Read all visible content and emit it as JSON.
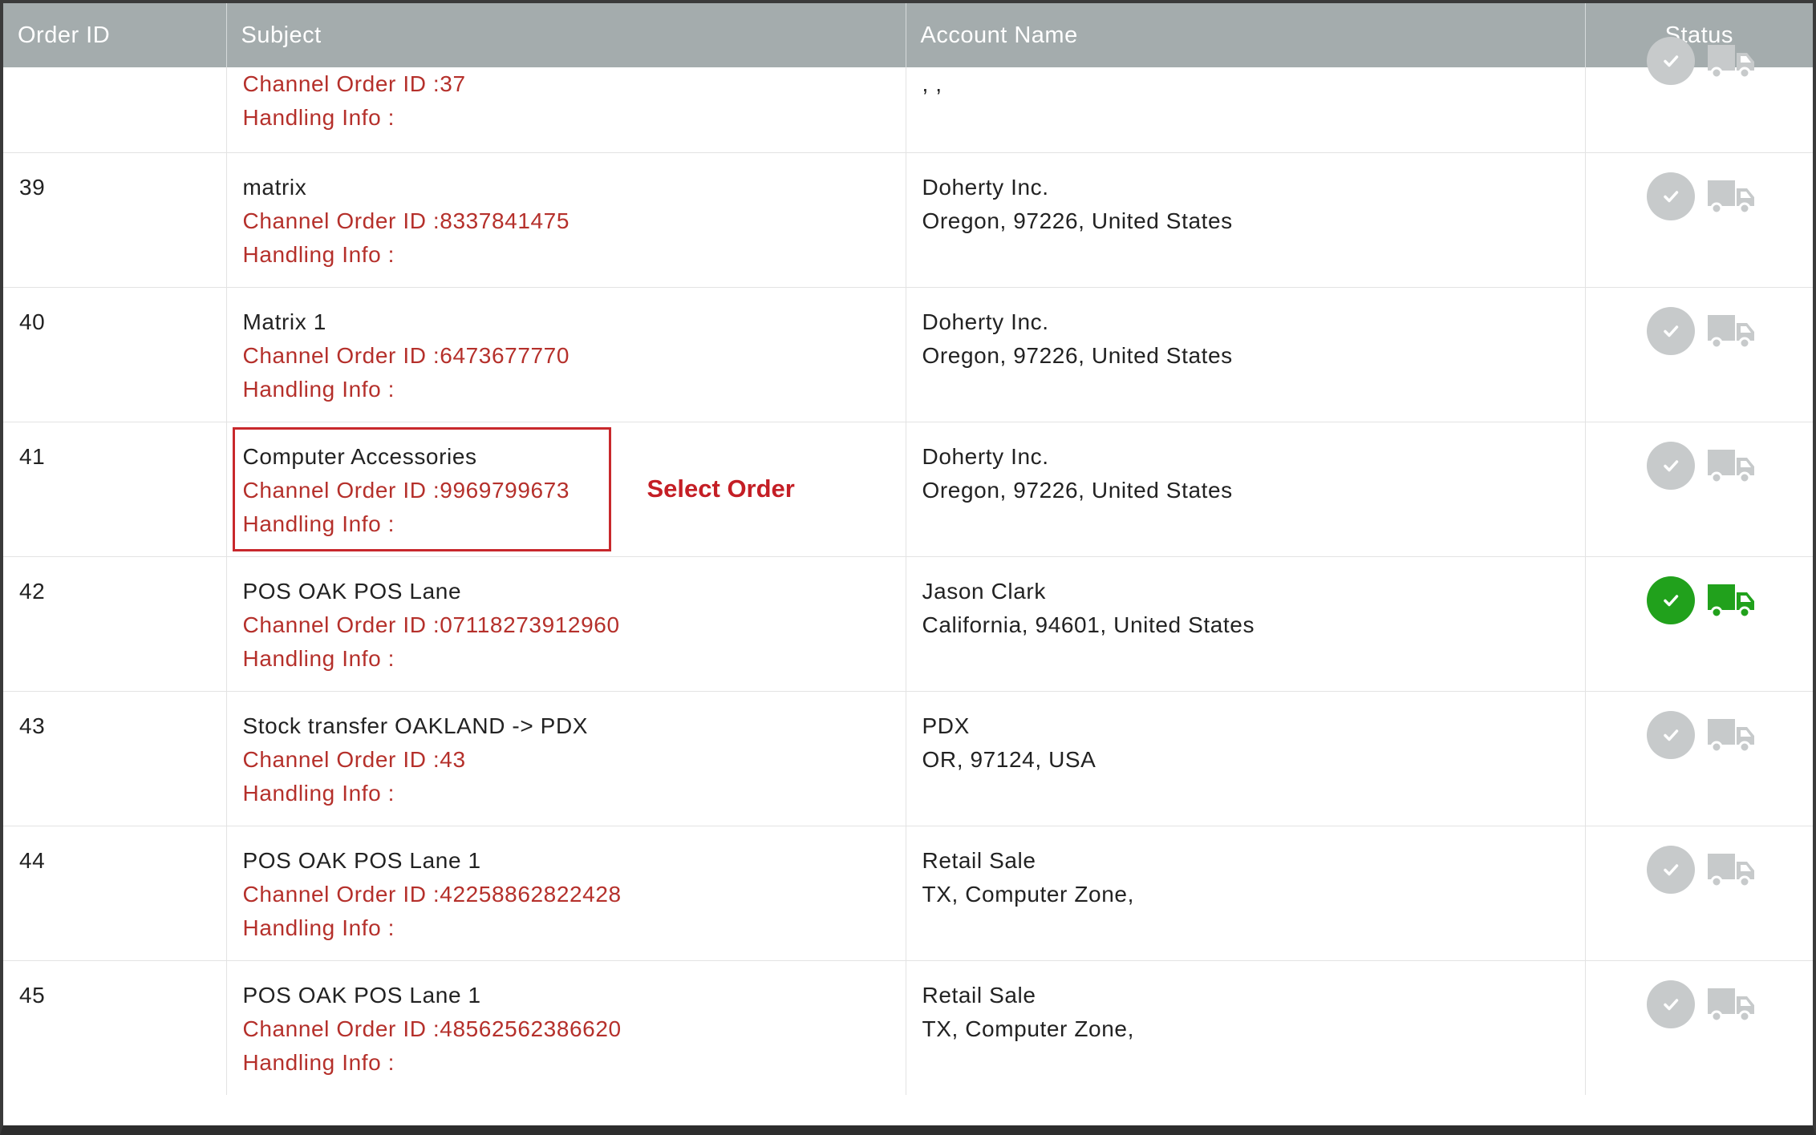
{
  "table": {
    "headers": {
      "order_id": "Order ID",
      "subject": "Subject",
      "account_name": "Account Name",
      "status": "Status"
    },
    "partial_row": {
      "channel": "Channel Order ID :37",
      "handling": "Handling Info :",
      "account": ", ,"
    },
    "rows": [
      {
        "id": "39",
        "subject": "matrix",
        "channel": "Channel Order ID :8337841475",
        "handling": "Handling Info :",
        "account_name": "Doherty Inc.",
        "account_address": "Oregon, 97226, United States",
        "status": "inactive"
      },
      {
        "id": "40",
        "subject": "Matrix 1",
        "channel": "Channel Order ID :6473677770",
        "handling": "Handling Info :",
        "account_name": "Doherty Inc.",
        "account_address": "Oregon, 97226, United States",
        "status": "inactive"
      },
      {
        "id": "41",
        "subject": "Computer Accessories",
        "channel": "Channel Order ID :9969799673",
        "handling": "Handling Info :",
        "account_name": "Doherty Inc.",
        "account_address": "Oregon, 97226, United States",
        "status": "inactive"
      },
      {
        "id": "42",
        "subject": "POS OAK POS Lane",
        "channel": "Channel Order ID :07118273912960",
        "handling": "Handling Info :",
        "account_name": "Jason Clark",
        "account_address": "California, 94601, United States",
        "status": "active"
      },
      {
        "id": "43",
        "subject": "Stock transfer OAKLAND -> PDX",
        "channel": "Channel Order ID :43",
        "handling": "Handling Info :",
        "account_name": "PDX",
        "account_address": "OR, 97124, USA",
        "status": "inactive"
      },
      {
        "id": "44",
        "subject": "POS OAK POS Lane 1",
        "channel": "Channel Order ID :42258862822428",
        "handling": "Handling Info :",
        "account_name": "Retail Sale",
        "account_address": "TX, Computer Zone,",
        "status": "inactive"
      },
      {
        "id": "45",
        "subject": "POS OAK POS Lane 1",
        "channel": "Channel Order ID :48562562386620",
        "handling": "Handling Info :",
        "account_name": "Retail Sale",
        "account_address": "TX, Computer Zone,",
        "status": "inactive"
      }
    ]
  },
  "annotation": {
    "label": "Select Order",
    "color": "#c41e25"
  },
  "icons": {
    "status_check": "check-circle-icon",
    "status_ship": "truck-icon"
  },
  "colors": {
    "header_bg": "#a4acad",
    "link_red": "#b5302b",
    "active_green": "#21a11c",
    "inactive_gray": "#c7cacb"
  }
}
